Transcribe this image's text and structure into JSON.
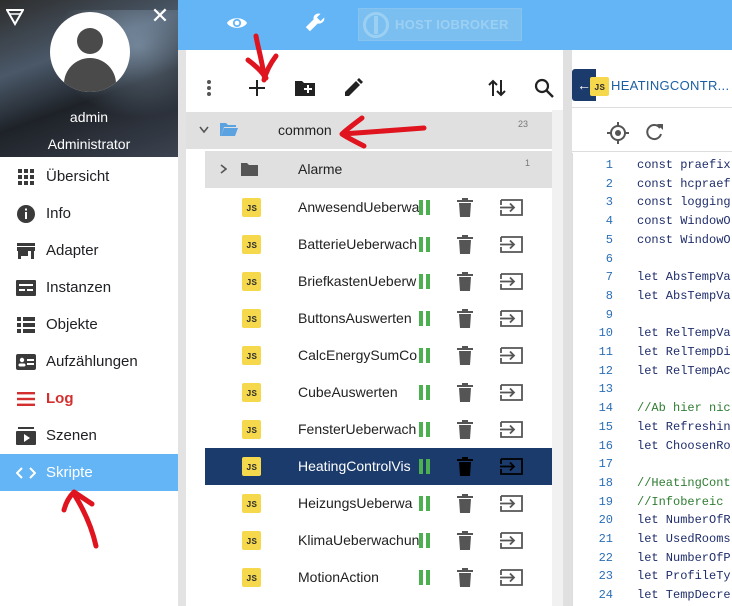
{
  "sidebar": {
    "username": "admin",
    "role": "Administrator",
    "items": [
      {
        "label": "Übersicht",
        "icon": "grid-icon"
      },
      {
        "label": "Info",
        "icon": "info-icon"
      },
      {
        "label": "Adapter",
        "icon": "store-icon"
      },
      {
        "label": "Instanzen",
        "icon": "instances-icon"
      },
      {
        "label": "Objekte",
        "icon": "list-icon"
      },
      {
        "label": "Aufzählungen",
        "icon": "badge-list-icon"
      },
      {
        "label": "Log",
        "icon": "log-icon"
      },
      {
        "label": "Szenen",
        "icon": "scenes-icon"
      },
      {
        "label": "Skripte",
        "icon": "code-icon"
      }
    ]
  },
  "topbar": {
    "host_label": "HOST IOBROKER"
  },
  "tree": {
    "root_folder": {
      "label": "common",
      "count": "23"
    },
    "subfolder": {
      "label": "Alarme",
      "count": "1"
    },
    "scripts": [
      {
        "label": "AnwesendUeberwa"
      },
      {
        "label": "BatterieUeberwach"
      },
      {
        "label": "BriefkastenUeberw"
      },
      {
        "label": "ButtonsAuswerten"
      },
      {
        "label": "CalcEnergySumCo"
      },
      {
        "label": "CubeAuswerten"
      },
      {
        "label": "FensterUeberwach"
      },
      {
        "label": "HeatingControlVis"
      },
      {
        "label": "HeizungsUeberwa"
      },
      {
        "label": "KlimaUeberwachun"
      },
      {
        "label": "MotionAction"
      }
    ],
    "js_badge": "JS"
  },
  "editor": {
    "tab_badge": "JS",
    "tab_title": "HEATINGCONTR...",
    "lines": [
      {
        "n": "1",
        "code": "const praefix"
      },
      {
        "n": "2",
        "code": "const hcpraef"
      },
      {
        "n": "3",
        "code": "const logging"
      },
      {
        "n": "4",
        "code": "const WindowO"
      },
      {
        "n": "5",
        "code": "const WindowO"
      },
      {
        "n": "6",
        "code": ""
      },
      {
        "n": "7",
        "code": "let AbsTempVa"
      },
      {
        "n": "8",
        "code": "let AbsTempVa"
      },
      {
        "n": "9",
        "code": ""
      },
      {
        "n": "10",
        "code": "let RelTempVa"
      },
      {
        "n": "11",
        "code": "let RelTempDi"
      },
      {
        "n": "12",
        "code": "let RelTempAc"
      },
      {
        "n": "13",
        "code": ""
      },
      {
        "n": "14",
        "code": "//Ab hier nic"
      },
      {
        "n": "15",
        "code": "let Refreshin"
      },
      {
        "n": "16",
        "code": "let ChoosenRo"
      },
      {
        "n": "17",
        "code": ""
      },
      {
        "n": "18",
        "code": "//HeatingCont"
      },
      {
        "n": "19",
        "code": "//Infobereic"
      },
      {
        "n": "20",
        "code": "let NumberOfR"
      },
      {
        "n": "21",
        "code": "let UsedRooms"
      },
      {
        "n": "22",
        "code": "let NumberOfP"
      },
      {
        "n": "23",
        "code": "let ProfileTy"
      },
      {
        "n": "24",
        "code": "let TempDecre"
      }
    ]
  },
  "colors": {
    "accent": "#64b5f6",
    "selected_row": "#1b3b6c",
    "log_red": "#d32f2f",
    "run_green": "#4caf50",
    "js_yellow": "#f5d84c"
  }
}
